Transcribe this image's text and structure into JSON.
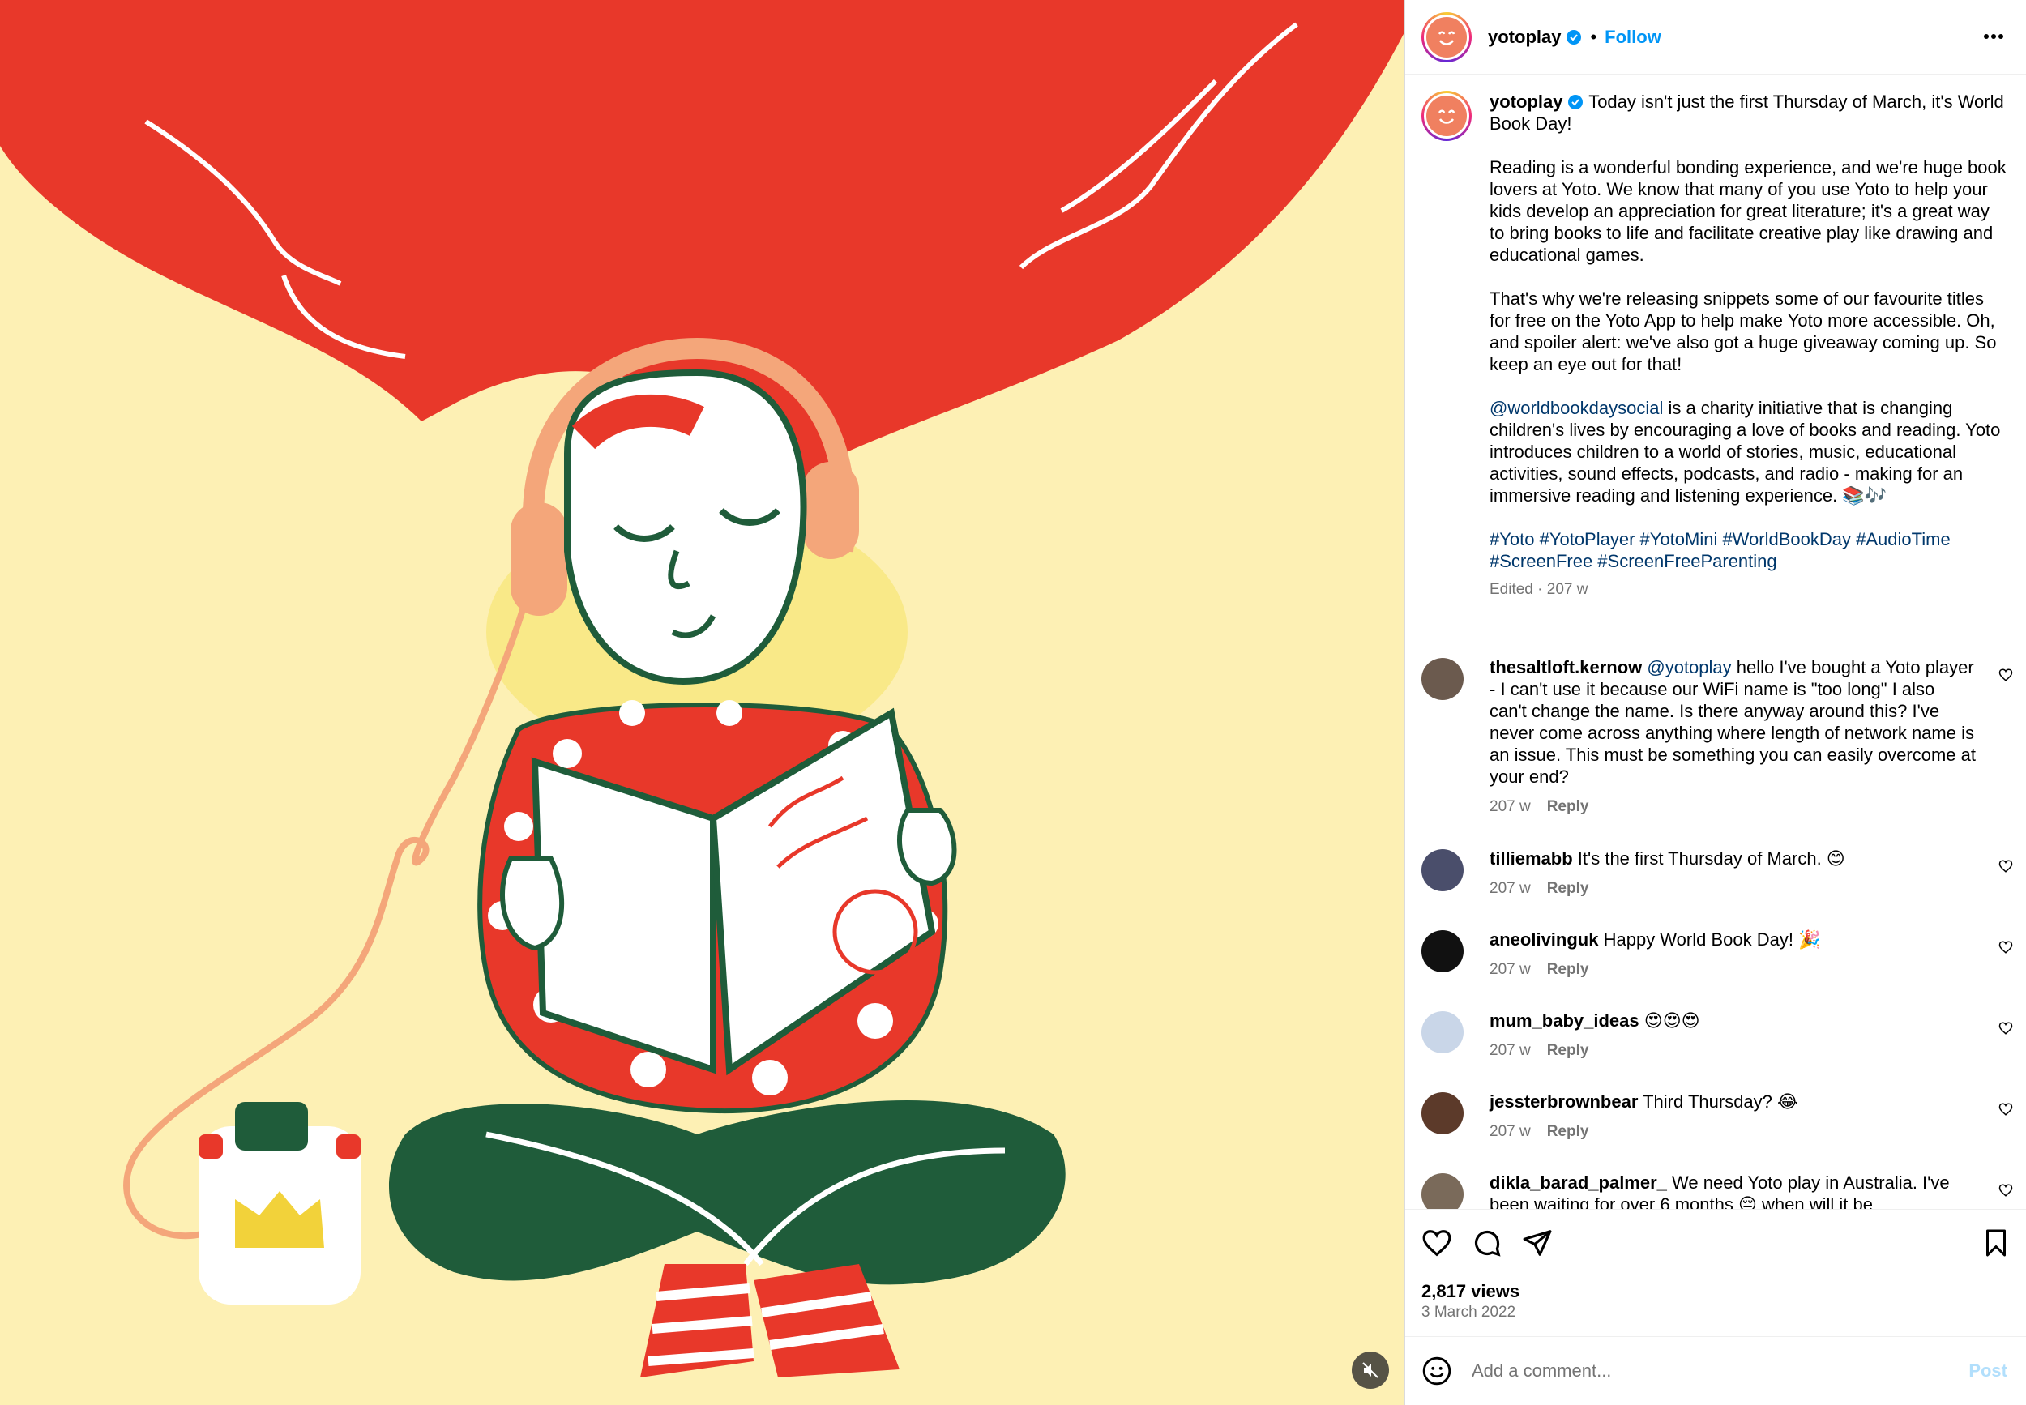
{
  "post": {
    "username": "yotoplay",
    "follow_label": "Follow",
    "separator": "•"
  },
  "caption": {
    "username": "yotoplay",
    "line1": "Today isn't just the first Thursday of March, it's World Book Day!",
    "p2": "Reading is a wonderful bonding experience, and we're huge book lovers at Yoto. We know that many of you use Yoto to help your kids develop an appreciation for great literature; it's a great way to bring books to life and facilitate creative play like drawing and educational games.",
    "p3": "That's why we're releasing snippets some of our favourite titles for free on the Yoto App to help make Yoto more accessible. Oh, and spoiler alert: we've also got a huge giveaway coming up. So keep an eye out for that!",
    "p4_mention": "@worldbookdaysocial",
    "p4_text": " is a charity initiative that is changing children's lives by encouraging a love of books and reading. Yoto introduces children to a world of stories, music, educational activities, sound effects, podcasts, and radio - making for an immersive reading and listening experience. 📚🎶",
    "hashtags": "#Yoto #YotoPlayer #YotoMini #WorldBookDay #AudioTime #ScreenFree #ScreenFreeParenting",
    "meta": "Edited · 207 w"
  },
  "comments": [
    {
      "user": "thesaltloft.kernow",
      "mention": "@yotoplay",
      "text": " hello I've bought a Yoto player - I can't use it because our WiFi name is \"too long\" I also can't change the name. Is there anyway around this? I've never come across anything where length of network name is an issue. This must be something you can easily overcome at your end?",
      "time": "207 w",
      "reply": "Reply",
      "avatar_color": "#6b5a4e"
    },
    {
      "user": "tilliemabb",
      "mention": "",
      "text": " It's the first Thursday of March. 😊",
      "time": "207 w",
      "reply": "Reply",
      "avatar_color": "#4a4e6b"
    },
    {
      "user": "aneolivinguk",
      "mention": "",
      "text": " Happy World Book Day! 🎉",
      "time": "207 w",
      "reply": "Reply",
      "avatar_color": "#111111"
    },
    {
      "user": "mum_baby_ideas",
      "mention": "",
      "text": " 😍😍😍",
      "time": "207 w",
      "reply": "Reply",
      "avatar_color": "#c9d6e8"
    },
    {
      "user": "jessterbrownbear",
      "mention": "",
      "text": " Third Thursday? 😂",
      "time": "207 w",
      "reply": "Reply",
      "avatar_color": "#5c3a2a"
    },
    {
      "user": "dikla_barad_palmer_",
      "mention": "",
      "text": " We need Yoto play in Australia. I've been waiting for over 6 months 😔 when will it be",
      "time": "",
      "reply": "",
      "avatar_color": "#7a6a5a"
    }
  ],
  "stats": {
    "views": "2,817 views",
    "date": "3 March 2022"
  },
  "add_comment": {
    "placeholder": "Add a comment...",
    "post_label": "Post"
  },
  "colors": {
    "link_blue": "#0095f6",
    "dark_link": "#00376b",
    "muted": "#737373",
    "illustration_bg": "#fdf0b4",
    "hair_red": "#e8382a"
  },
  "icons": [
    "verified-icon",
    "more-options-icon",
    "heart-icon",
    "comment-icon",
    "share-icon",
    "bookmark-icon",
    "emoji-icon",
    "mute-icon"
  ]
}
